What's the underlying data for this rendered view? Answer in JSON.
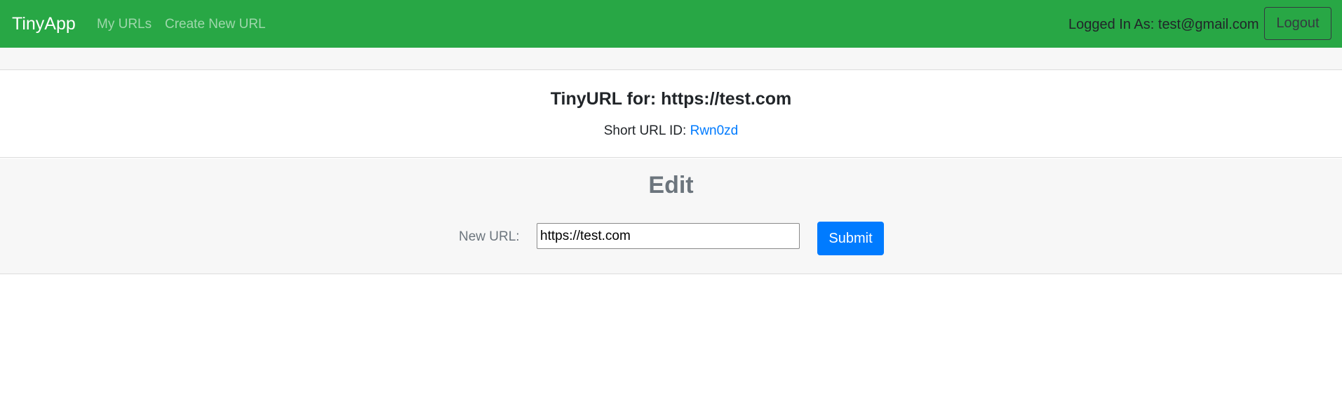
{
  "navbar": {
    "brand": "TinyApp",
    "links": [
      "My URLs",
      "Create New URL"
    ],
    "logged_in_text": "Logged In As: test@gmail.com",
    "logout_label": "Logout",
    "background_color": "#28a745"
  },
  "info": {
    "title": "TinyURL for: https://test.com",
    "short_label": "Short URL ID:",
    "short_id": "Rwn0zd",
    "link_color": "#007bff"
  },
  "edit": {
    "heading": "Edit",
    "new_url_label": "New URL:",
    "input_value": "https://test.com",
    "submit_label": "Submit",
    "submit_color": "#007bff"
  }
}
